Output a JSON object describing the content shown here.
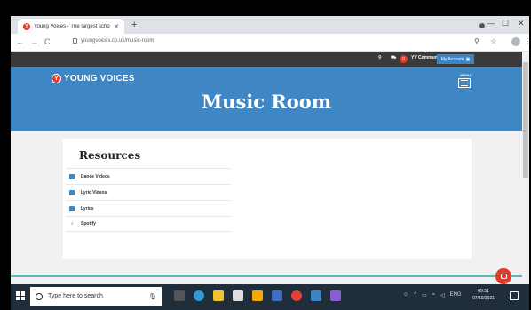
{
  "browser": {
    "tab_title": "Young Voices - The largest school...",
    "tab_close": "✕",
    "new_tab": "+",
    "url": "youngvoices.co.uk/music-room",
    "nav_back": "←",
    "nav_forward": "→",
    "nav_reload": "C",
    "win_min": "—",
    "win_max": "☐",
    "win_close": "✕",
    "zoom_icon": "⚲",
    "star": "☆",
    "menu": "⋮"
  },
  "site": {
    "top_strip": {
      "search_icon": "search-icon",
      "cart_count": "0",
      "community_label": "YV Community",
      "account_label": "My Account"
    },
    "logo_text": "YOUNG VOICES",
    "menu_label": "MENU",
    "page_title": "Music Room",
    "resources": {
      "title": "Resources",
      "items": [
        {
          "label": "Dance Videos",
          "icon": "video-icon"
        },
        {
          "label": "Lyric Videos",
          "icon": "video-icon"
        },
        {
          "label": "Lyrics",
          "icon": "document-icon"
        },
        {
          "label": "Spotify",
          "icon": "music-note-icon"
        }
      ]
    }
  },
  "taskbar": {
    "search_placeholder": "Type here to search",
    "time": "09:51",
    "date": "07/10/2021",
    "tray_lang": "ENG"
  },
  "colors": {
    "brand_blue": "#3f86c4",
    "brand_red": "#e13b2b",
    "dark_strip": "#3a3a3a",
    "taskbar": "#1f2e3a"
  }
}
